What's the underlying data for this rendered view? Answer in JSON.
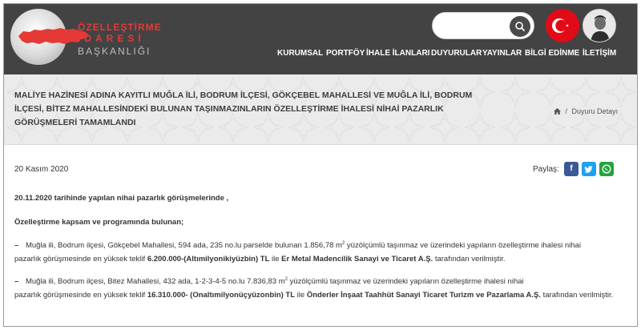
{
  "header": {
    "logo": {
      "line1": "ÖZELLEŞTİRME",
      "line2": "İDARESİ",
      "line3": "BAŞKANLIĞI"
    },
    "search": {
      "placeholder": "",
      "icon": "search-icon"
    },
    "nav": [
      "KURUMSAL",
      "PORTFÖY",
      "İHALE İLANLARI",
      "DUYURULAR",
      "YAYINLAR",
      "BİLGİ EDİNME",
      "İLETİŞİM"
    ]
  },
  "banner": {
    "title_lines": [
      "MALİYE HAZİNESİ ADINA KAYITLI MUĞLA İLİ, BODRUM İLÇESİ, GÖKÇEBEL MAHALLESİ VE MUĞLA İLİ, BODRUM",
      "İLÇESİ, BİTEZ MAHALLESİNDEKİ BULUNAN TAŞINMAZINLARIN ÖZELLEŞTİRME İHALESİ NİHAİ PAZARLIK",
      "GÖRÜŞMELERİ TAMAMLANDI"
    ],
    "breadcrumb": {
      "separator": "/",
      "current": "Duyuru Detayı"
    }
  },
  "article": {
    "date": "20 Kasım 2020",
    "share_label": "Paylaş:",
    "share": {
      "facebook": "f",
      "twitter": "t",
      "whatsapp": "w"
    },
    "p1": "20.11.2020 tarihinde yapılan nihai pazarlık görüşmelerinde ,",
    "p2": "Özelleştirme kapsam ve programında bulunan;",
    "item1": {
      "dash": "–",
      "line1": "Muğla ili, Bodrum ilçesi, Gökçebel Mahallesi, 594 ada, 235 no.lu parselde bulunan 1.856,78 m",
      "sup": "2",
      "line1_rest": " yüzölçümlü taşınmaz ve üzerindeki yapıların özelleştirme ihalesi nihai",
      "line2_a": "pazarlık görüşmesinde en yüksek teklif ",
      "amount": "6.200.000-(Altımilyonikiyüzbin) TL",
      "line2_b": " ile ",
      "company": "Er Metal Madencilik Sanayi ve Ticaret A.Ş.",
      "line2_c": " tarafından verilmiştir."
    },
    "item2": {
      "dash": "–",
      "line1": "Muğla ili, Bodrum ilçesi, Bitez Mahallesi, 432 ada, 1-2-3-4-5 no.lu 7.836,83 m",
      "sup": "2",
      "line1_rest": " yüzölçümlü taşınmaz ve üzerindeki yapıların özelleştirme ihalesi nihai",
      "line2_a": "pazarlık görüşmesinde en yüksek teklif ",
      "amount": "16.310.000- (Onaltımilyonüçyüzonbin) TL",
      "line2_b": " ile ",
      "company": "Önderler İnşaat Taahhüt Sanayi Ticaret Turizm ve Pazarlama A.Ş.",
      "line2_c": "  tarafından verilmiştir."
    }
  },
  "colors": {
    "header_bg": "#434343",
    "banner_bg": "#ebebeb",
    "logo_red": "#e53935",
    "flag_red": "#e30a17",
    "facebook": "#3b5998",
    "twitter": "#1da1f2",
    "whatsapp": "#25a340"
  }
}
